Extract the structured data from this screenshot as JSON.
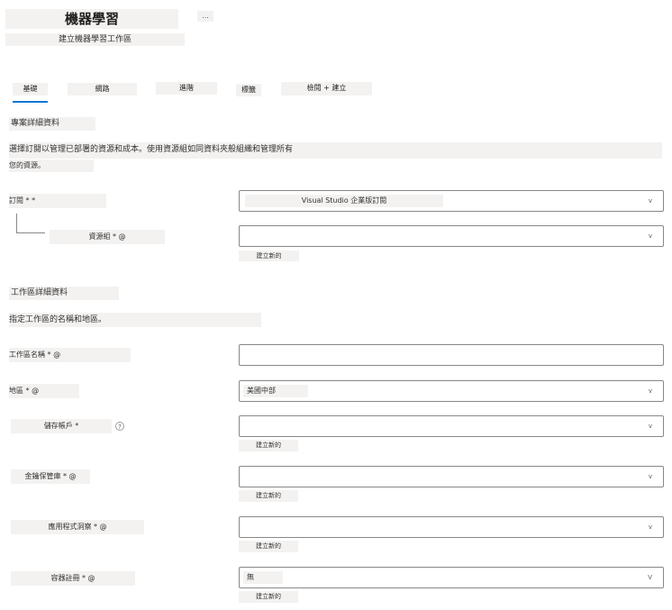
{
  "header": {
    "title": "機器學習",
    "subtitle": "建立機器學習工作區",
    "more_label": "..."
  },
  "tabs": [
    {
      "label": "基礎"
    },
    {
      "label": "網路"
    },
    {
      "label": "進階"
    },
    {
      "label": "標籤"
    },
    {
      "label": "檢閱 + 建立"
    }
  ],
  "project": {
    "heading": "專案詳細資料",
    "description_line1": "選擇訂閱以管理已部署的資源和成本。使用資源組如同資料夾般組織和管理所有",
    "description_line2": "您的資源。",
    "subscription_label": "訂閱 * *",
    "subscription_value": "Visual Studio 企業版訂閱",
    "resource_group_label": "資源組 * @",
    "resource_group_value": "",
    "create_new": "建立新的"
  },
  "workspace": {
    "heading": "工作區詳細資料",
    "description": "指定工作區的名稱和地區。",
    "name_label": "工作區名稱 * @",
    "name_value": "",
    "region_label": "地區 * @",
    "region_value": "美國中部",
    "storage_label": "儲存帳戶 *",
    "storage_info": "?",
    "storage_create": "建立新的",
    "keyvault_label": "金鑰保管庫 * @",
    "keyvault_create": "建立新的",
    "appinsights_label": "應用程式洞察 * @",
    "appinsights_create": "建立新的",
    "registry_label": "容器註冊 * @",
    "registry_value": "無",
    "registry_create": "建立新的"
  },
  "icons": {
    "chevron": "chevron-down-icon",
    "chevron_glyph": "v",
    "chevron_glyph_upper": "V"
  },
  "colors": {
    "accent": "#0078d4",
    "border": "#8a8886",
    "highlight": "#f3f2f1"
  }
}
